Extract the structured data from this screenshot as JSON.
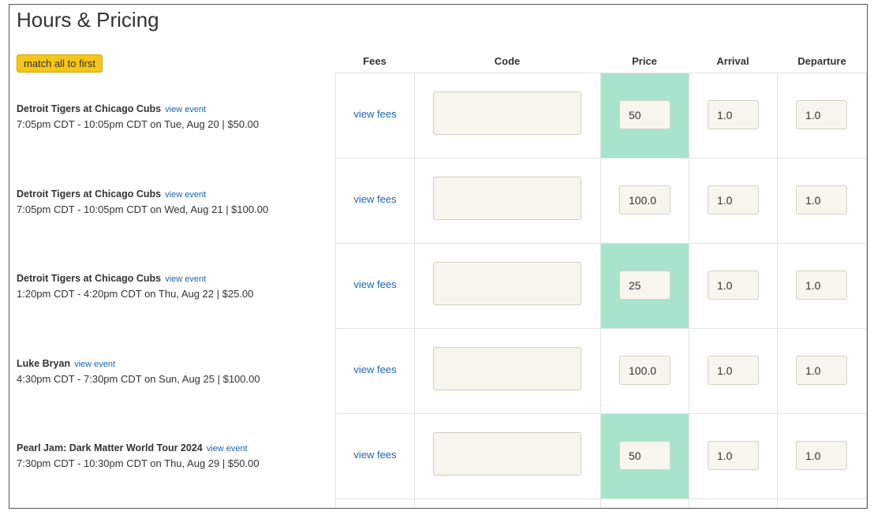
{
  "page": {
    "title": "Hours & Pricing"
  },
  "toolbar": {
    "match_label": "match all to first"
  },
  "columns": {
    "fees": "Fees",
    "code": "Code",
    "price": "Price",
    "arrival": "Arrival",
    "departure": "Departure"
  },
  "colors": {
    "price_highlight": "#a8e4cc",
    "match_button": "#f5c518",
    "link": "#1a66b3"
  },
  "rows": [
    {
      "name": "Detroit Tigers at Chicago Cubs",
      "view_event": "view event",
      "time": "7:05pm CDT - 10:05pm CDT on Tue, Aug 20 | $50.00",
      "fees_link": "view fees",
      "code": "",
      "price": "50",
      "price_highlighted": true,
      "arrival": "1.0",
      "departure": "1.0"
    },
    {
      "name": "Detroit Tigers at Chicago Cubs",
      "view_event": "view event",
      "time": "7:05pm CDT - 10:05pm CDT on Wed, Aug 21 | $100.00",
      "fees_link": "view fees",
      "code": "",
      "price": "100.0",
      "price_highlighted": false,
      "arrival": "1.0",
      "departure": "1.0"
    },
    {
      "name": "Detroit Tigers at Chicago Cubs",
      "view_event": "view event",
      "time": "1:20pm CDT - 4:20pm CDT on Thu, Aug 22 | $25.00",
      "fees_link": "view fees",
      "code": "",
      "price": "25",
      "price_highlighted": true,
      "arrival": "1.0",
      "departure": "1.0"
    },
    {
      "name": "Luke Bryan",
      "view_event": "view event",
      "time": "4:30pm CDT - 7:30pm CDT on Sun, Aug 25 | $100.00",
      "fees_link": "view fees",
      "code": "",
      "price": "100.0",
      "price_highlighted": false,
      "arrival": "1.0",
      "departure": "1.0"
    },
    {
      "name": "Pearl Jam: Dark Matter World Tour 2024",
      "view_event": "view event",
      "time": "7:30pm CDT - 10:30pm CDT on Thu, Aug 29 | $50.00",
      "fees_link": "view fees",
      "code": "",
      "price": "50",
      "price_highlighted": true,
      "arrival": "1.0",
      "departure": "1.0"
    }
  ]
}
